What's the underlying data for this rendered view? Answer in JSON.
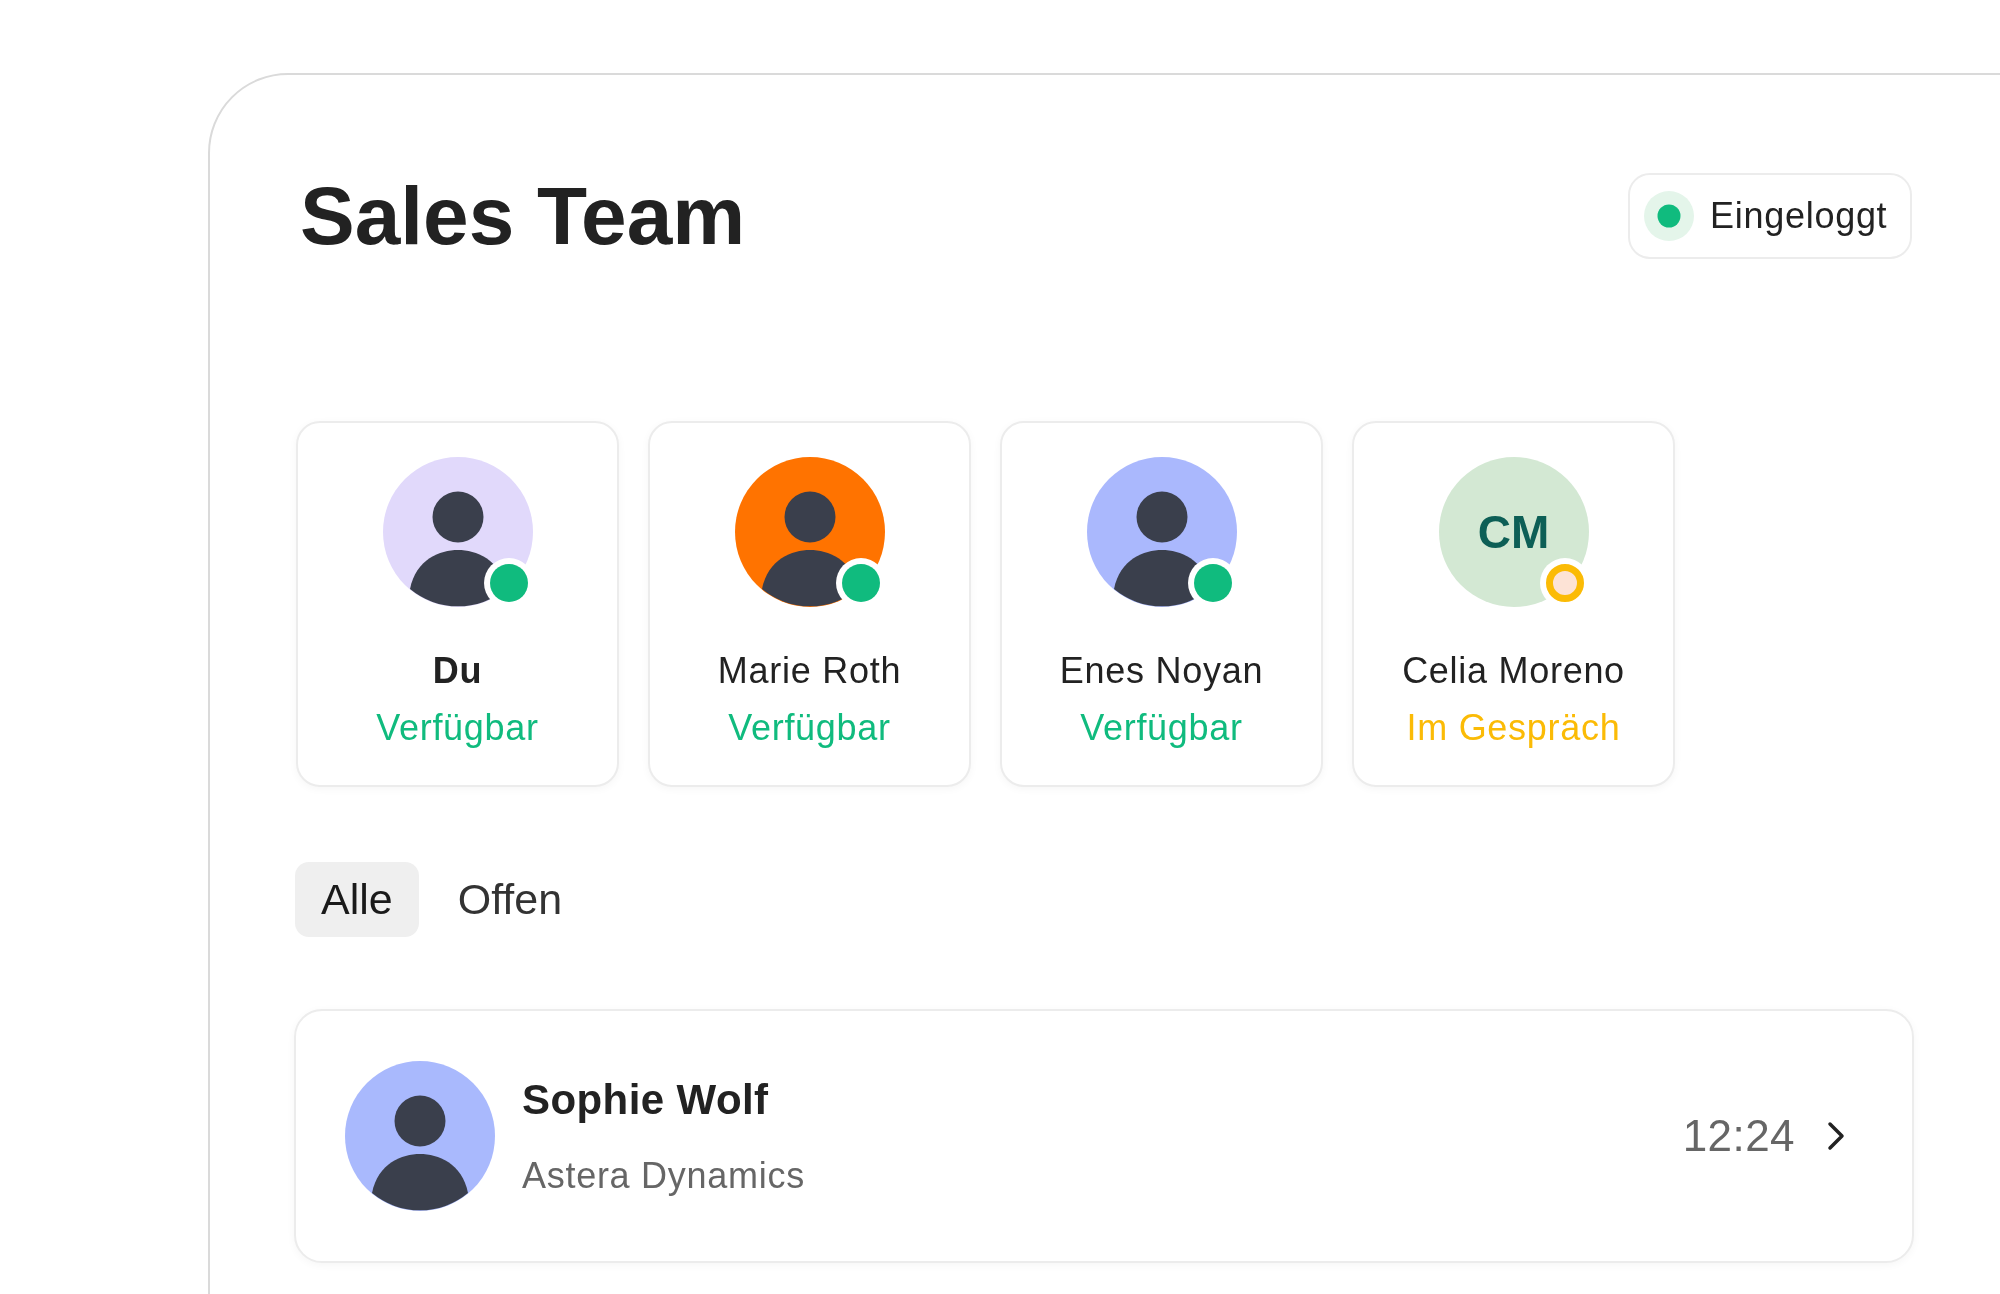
{
  "header": {
    "title": "Sales Team",
    "presence": {
      "label": "Eingeloggt",
      "online": true
    }
  },
  "members": [
    {
      "name": "Du",
      "is_self": true,
      "avatar": {
        "kind": "photo",
        "color": "#e1d9fb"
      },
      "status": {
        "kind": "available",
        "label": "Verfügbar",
        "color": "#10bb7e"
      }
    },
    {
      "name": "Marie Roth",
      "is_self": false,
      "avatar": {
        "kind": "photo",
        "color": "#ff7300"
      },
      "status": {
        "kind": "available",
        "label": "Verfügbar",
        "color": "#10bb7e"
      }
    },
    {
      "name": "Enes Noyan",
      "is_self": false,
      "avatar": {
        "kind": "photo",
        "color": "#aab8fd"
      },
      "status": {
        "kind": "available",
        "label": "Verfügbar",
        "color": "#10bb7e"
      }
    },
    {
      "name": "Celia Moreno",
      "is_self": false,
      "avatar": {
        "kind": "initials",
        "initials": "CM",
        "color": "#d3e8d3"
      },
      "status": {
        "kind": "busy",
        "label": "Im Gespräch",
        "color": "#fbbb06"
      }
    }
  ],
  "tabs": [
    {
      "label": "Alle",
      "selected": true
    },
    {
      "label": "Offen",
      "selected": false
    }
  ],
  "conversations": [
    {
      "name": "Sophie Wolf",
      "company": "Astera Dynamics",
      "time": "12:24",
      "avatar": {
        "kind": "photo",
        "color": "#a9b9fd"
      }
    }
  ]
}
